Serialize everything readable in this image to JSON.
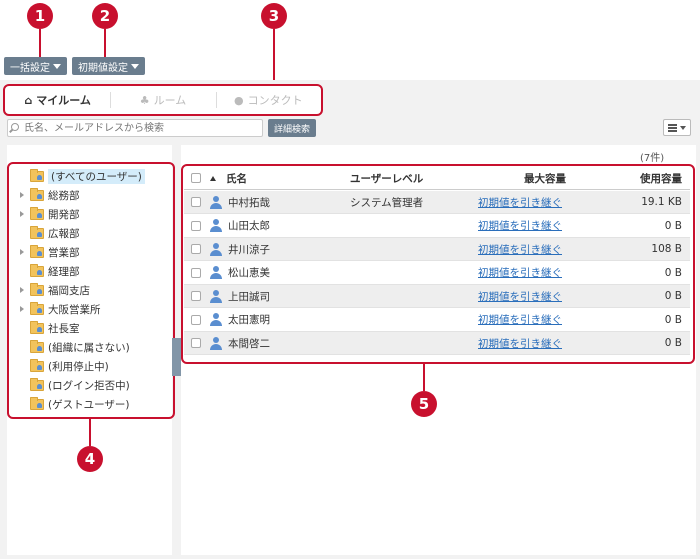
{
  "callouts": [
    "1",
    "2",
    "3",
    "4",
    "5"
  ],
  "toolbar": {
    "bulk_settings": "一括設定",
    "initial_settings": "初期値設定"
  },
  "tabs": [
    {
      "label": "マイルーム",
      "icon": "home-icon",
      "active": true
    },
    {
      "label": "ルーム",
      "icon": "room-icon",
      "active": false
    },
    {
      "label": "コンタクト",
      "icon": "contact-icon",
      "active": false
    }
  ],
  "search": {
    "placeholder": "氏名、メールアドレスから検索",
    "advanced_label": "詳細検索"
  },
  "result_count": "(7件)",
  "tree": [
    {
      "label": "(すべてのユーザー)",
      "expandable": false,
      "selected": true
    },
    {
      "label": "総務部",
      "expandable": true
    },
    {
      "label": "開発部",
      "expandable": true
    },
    {
      "label": "広報部",
      "expandable": false
    },
    {
      "label": "営業部",
      "expandable": true
    },
    {
      "label": "経理部",
      "expandable": false
    },
    {
      "label": "福岡支店",
      "expandable": true
    },
    {
      "label": "大阪営業所",
      "expandable": true
    },
    {
      "label": "社長室",
      "expandable": false
    },
    {
      "label": "(組織に属さない)",
      "expandable": false
    },
    {
      "label": "(利用停止中)",
      "expandable": false
    },
    {
      "label": "(ログイン拒否中)",
      "expandable": false
    },
    {
      "label": "(ゲストユーザー)",
      "expandable": false
    }
  ],
  "table": {
    "headers": {
      "name": "氏名",
      "level": "ユーザーレベル",
      "max": "最大容量",
      "used": "使用容量"
    },
    "rows": [
      {
        "name": "中村拓哉",
        "level": "システム管理者",
        "max": "初期値を引き継ぐ",
        "used": "19.1 KB"
      },
      {
        "name": "山田太郎",
        "level": "",
        "max": "初期値を引き継ぐ",
        "used": "0 B"
      },
      {
        "name": "井川涼子",
        "level": "",
        "max": "初期値を引き継ぐ",
        "used": "108 B"
      },
      {
        "name": "松山恵美",
        "level": "",
        "max": "初期値を引き継ぐ",
        "used": "0 B"
      },
      {
        "name": "上田誠司",
        "level": "",
        "max": "初期値を引き継ぐ",
        "used": "0 B"
      },
      {
        "name": "太田憲明",
        "level": "",
        "max": "初期値を引き継ぐ",
        "used": "0 B"
      },
      {
        "name": "本間啓二",
        "level": "",
        "max": "初期値を引き継ぐ",
        "used": "0 B"
      }
    ]
  },
  "colors": {
    "callout": "#c8102e",
    "button": "#6a7d8e",
    "link": "#2a6ebb"
  }
}
